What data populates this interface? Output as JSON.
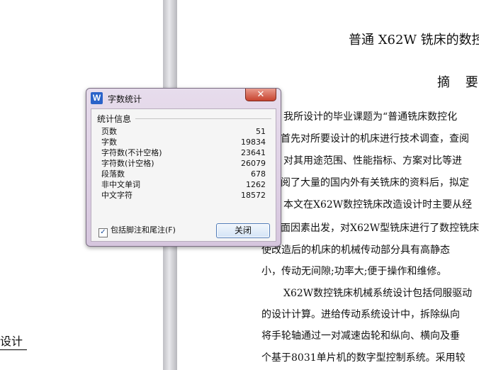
{
  "document": {
    "left_page_text": "设计",
    "title": "普通 X62W 铣床的数控",
    "abstract_heading": "摘 要",
    "body_lines": [
      "我所设计的毕业课题为“普通铣床数控化",
      "首先对所要设计的机床进行技术调查，查阅",
      "对其用途范围、性能指标、方案对比等进",
      "阅了大量的国内外有关铣床的资料后，拟定",
      "本文在X62W数控铣床改造设计时主要从经",
      "面因素出发，对X62W型铣床进行了数控铣床",
      "使改造后的机床的机械传动部分具有高静态",
      "小，传动无间隙;功率大;便于操作和维修。",
      "X62W数控铣床机械系统设计包括伺服驱动",
      "的设计计算。进给传动系统设计中，拆除纵向",
      "将手轮轴通过一对减速齿轮和纵向、横向及垂",
      "个基于8031单片机的数字型控制系统。采用较"
    ]
  },
  "dialog": {
    "title": "字数统计",
    "app_icon_letter": "W",
    "close_glyph": "✕",
    "section_label": "统计信息",
    "stats": [
      {
        "label": "页数",
        "value": "51"
      },
      {
        "label": "字数",
        "value": "19834"
      },
      {
        "label": "字符数(不计空格)",
        "value": "23641"
      },
      {
        "label": "字符数(计空格)",
        "value": "26079"
      },
      {
        "label": "段落数",
        "value": "678"
      },
      {
        "label": "非中文单词",
        "value": "1262"
      },
      {
        "label": "中文字符",
        "value": "18572"
      }
    ],
    "checkbox_label": "包括脚注和尾注(F)",
    "checkbox_checked": true,
    "close_button_label": "关闭"
  }
}
